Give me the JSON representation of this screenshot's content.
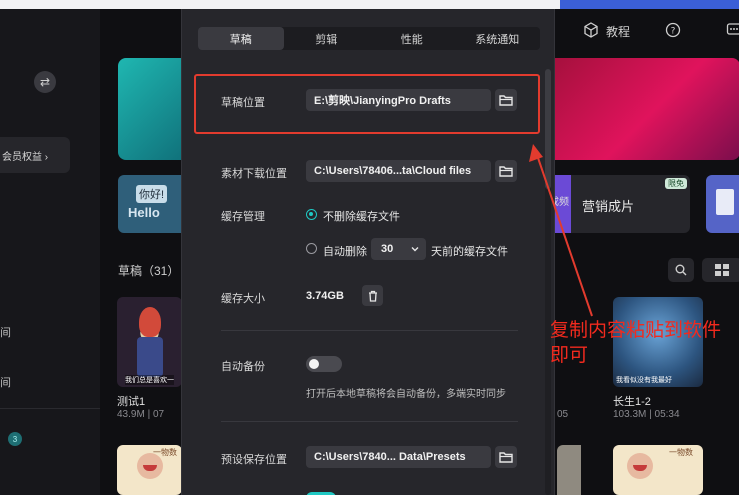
{
  "background": {
    "member_benefit": "会员权益 ›",
    "sidebar_fragment_1": "间",
    "sidebar_fragment_2": "间",
    "badge": "3",
    "hello_card": {
      "tag": "你好!",
      "text": "Hello"
    },
    "marketing_card": {
      "label": "营销成片",
      "badge": "限免",
      "side": "成频"
    },
    "drafts_heading": "草稿（31）",
    "drafts": [
      {
        "title": "测试1",
        "meta": "43.9M | 07",
        "caption": "我们总是喜欢一"
      },
      {
        "title": "长生1-2",
        "meta": "103.3M | 05:34",
        "caption": "我看似没有我最好"
      }
    ],
    "partial_meta": "05",
    "thumb_texts": [
      "一物数",
      "一物数"
    ],
    "toolbar": {
      "tutorial_label": "教程",
      "icons": [
        "cube-icon",
        "help-icon",
        "message-icon"
      ]
    }
  },
  "dialog": {
    "tabs": [
      {
        "label": "草稿",
        "active": true
      },
      {
        "label": "剪辑",
        "active": false
      },
      {
        "label": "性能",
        "active": false
      },
      {
        "label": "系统通知",
        "active": false
      }
    ],
    "draft_location": {
      "label": "草稿位置",
      "value": "E:\\剪映\\JianyingPro Drafts"
    },
    "material_download": {
      "label": "素材下载位置",
      "value": "C:\\Users\\78406...ta\\Cloud files"
    },
    "cache": {
      "label": "缓存管理",
      "option_keep": "不删除缓存文件",
      "option_auto": "自动删除",
      "days": "30",
      "days_suffix": "天前的缓存文件",
      "selected": "keep"
    },
    "cache_size": {
      "label": "缓存大小",
      "value": "3.74GB"
    },
    "auto_backup": {
      "label": "自动备份",
      "enabled": false,
      "hint": "打开后本地草稿将会自动备份，多端实时同步"
    },
    "preset_location": {
      "label": "预设保存位置",
      "value": "C:\\Users\\7840... Data\\Presets"
    }
  },
  "annotation": {
    "note": "复制内容粘贴到软件即可",
    "color": "#e23b2e"
  }
}
